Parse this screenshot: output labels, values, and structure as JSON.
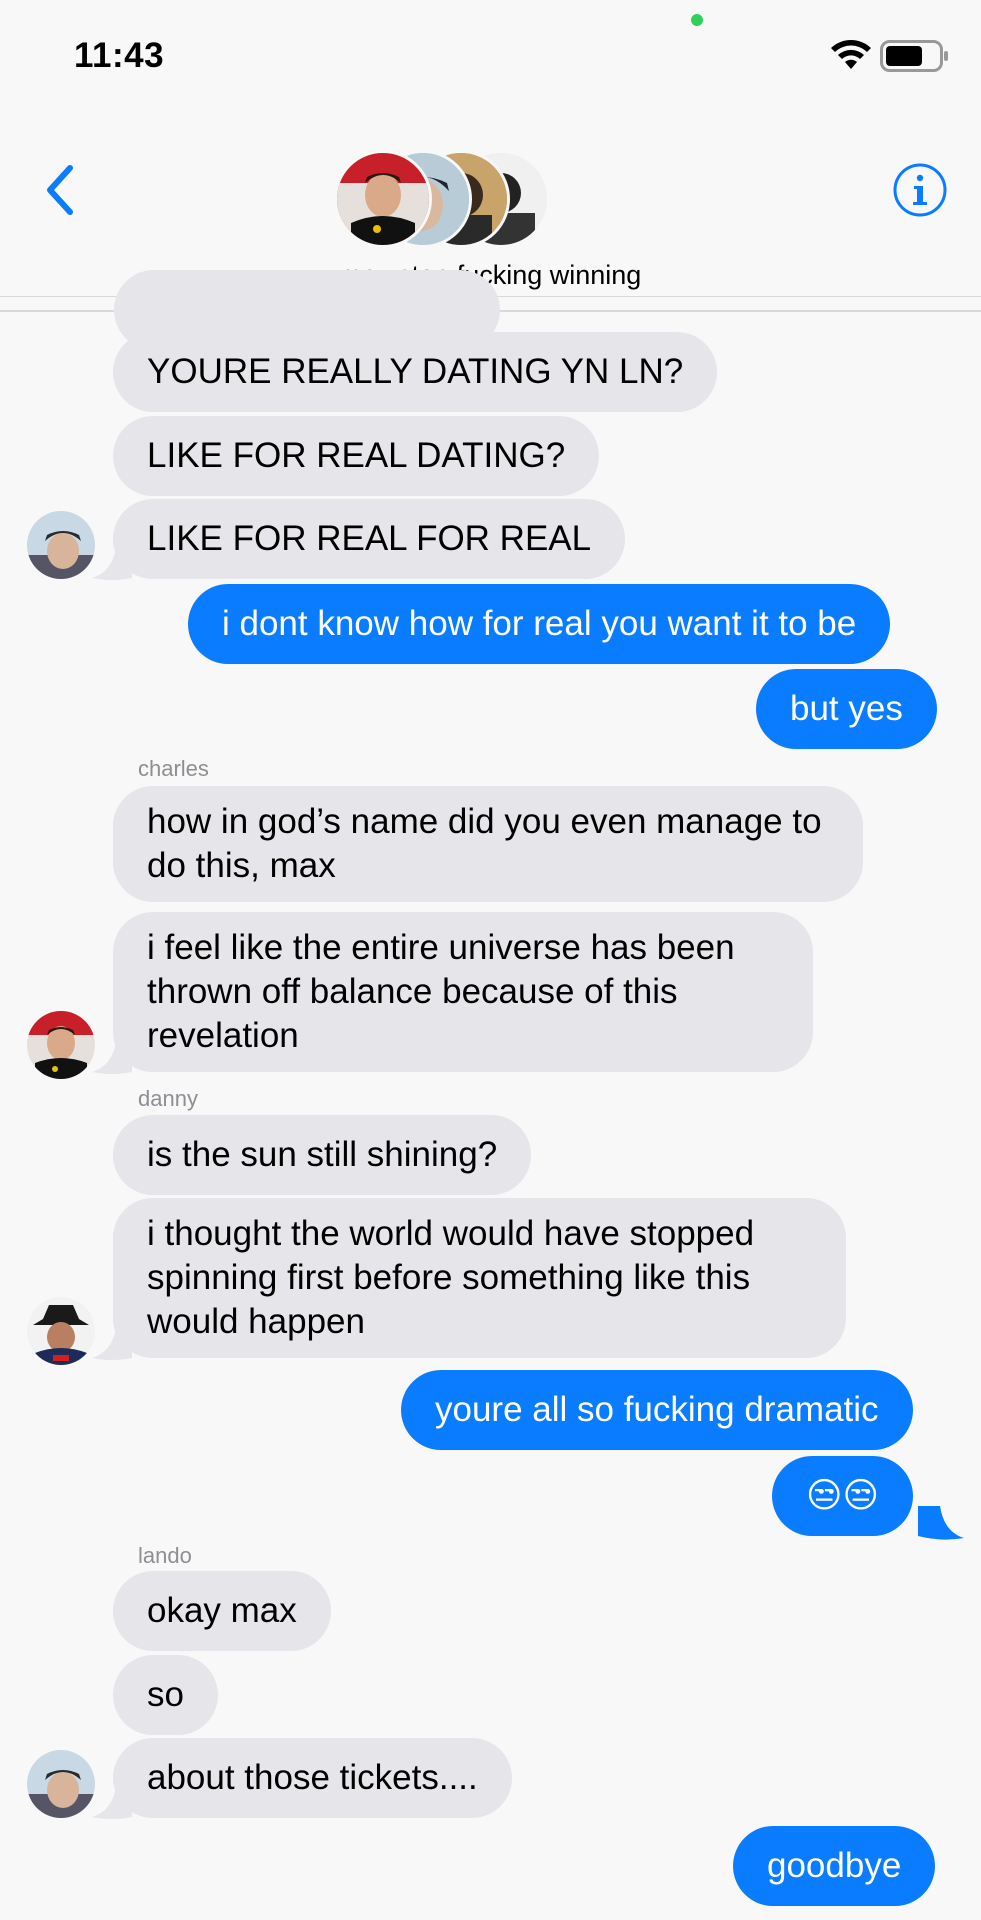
{
  "status_bar": {
    "time": "11:43"
  },
  "header": {
    "group_name": "max stop fucking winning"
  },
  "messages": [
    {
      "who": "in",
      "text": "YOURE REALLY DATING YN LN?"
    },
    {
      "who": "in",
      "text": "LIKE FOR REAL DATING?"
    },
    {
      "who": "in",
      "text": "LIKE FOR REAL FOR REAL"
    },
    {
      "who": "out",
      "text": "i dont know how for real you want it to be"
    },
    {
      "who": "out",
      "text": "but yes"
    },
    {
      "who": "sender",
      "text": "charles"
    },
    {
      "who": "in",
      "text": "how in god’s name did you even manage to do this, max"
    },
    {
      "who": "in",
      "text": "i feel like the entire universe has been thrown off balance because of this revelation"
    },
    {
      "who": "sender",
      "text": "danny"
    },
    {
      "who": "in",
      "text": "is the sun still shining?"
    },
    {
      "who": "in",
      "text": "i thought the world would have stopped spinning first before something like this would happen"
    },
    {
      "who": "out",
      "text": "youre all so fucking dramatic"
    },
    {
      "who": "out",
      "text": "😒😒"
    },
    {
      "who": "sender",
      "text": "lando"
    },
    {
      "who": "in",
      "text": "okay max"
    },
    {
      "who": "in",
      "text": "so"
    },
    {
      "who": "in",
      "text": "about those tickets...."
    },
    {
      "who": "out",
      "text": "goodbye"
    }
  ],
  "icons": {
    "back": "chevron-left-icon",
    "info": "info-icon",
    "wifi": "wifi-icon",
    "battery": "battery-icon"
  },
  "colors": {
    "accent": "#0a7cff",
    "incoming_bubble": "#e5e5ea",
    "background": "#f8f8f8",
    "sender_label": "#8e8e93"
  }
}
